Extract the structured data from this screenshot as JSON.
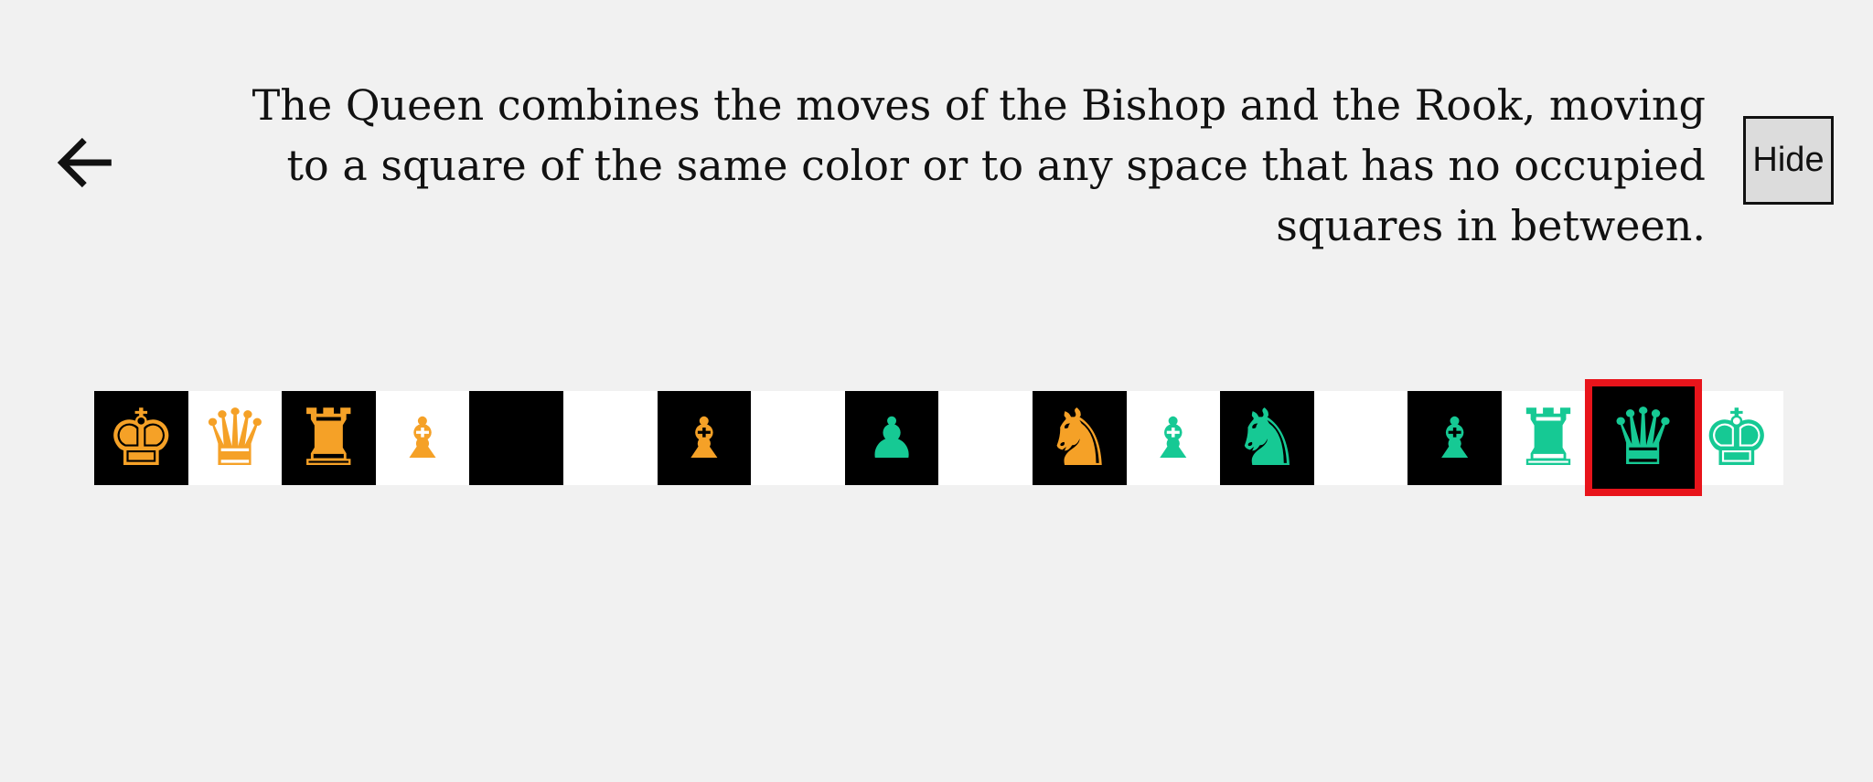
{
  "header": {
    "description": "The Queen combines the moves of the Bishop and the Rook, moving to a square of the same color or to any space that has no occupied squares in between.",
    "hide_label": "Hide",
    "back_icon": "arrow-left-icon"
  },
  "colors": {
    "background": "#f1f1f1",
    "orange_piece": "#f5a127",
    "green_piece": "#16c994",
    "selected_outline": "#e8141b"
  },
  "board_row": {
    "squares": [
      {
        "shade": "dark",
        "piece": "king",
        "color": "orange",
        "glyph": "♚",
        "selected": false
      },
      {
        "shade": "light",
        "piece": "queen",
        "color": "orange",
        "glyph": "♛",
        "selected": false
      },
      {
        "shade": "dark",
        "piece": "rook",
        "color": "orange",
        "glyph": "♜",
        "selected": false
      },
      {
        "shade": "light",
        "piece": "bishop",
        "color": "orange",
        "glyph": "♝",
        "selected": false
      },
      {
        "shade": "dark",
        "piece": "",
        "color": "",
        "glyph": "",
        "selected": false
      },
      {
        "shade": "light",
        "piece": "",
        "color": "",
        "glyph": "",
        "selected": false
      },
      {
        "shade": "dark",
        "piece": "bishop",
        "color": "orange",
        "glyph": "♝",
        "selected": false
      },
      {
        "shade": "light",
        "piece": "",
        "color": "",
        "glyph": "",
        "selected": false
      },
      {
        "shade": "dark",
        "piece": "pawn",
        "color": "green",
        "glyph": "♟",
        "selected": false
      },
      {
        "shade": "light",
        "piece": "",
        "color": "",
        "glyph": "",
        "selected": false
      },
      {
        "shade": "dark",
        "piece": "knight",
        "color": "orange",
        "glyph": "♞",
        "selected": false
      },
      {
        "shade": "light",
        "piece": "bishop",
        "color": "green",
        "glyph": "♝",
        "selected": false
      },
      {
        "shade": "dark",
        "piece": "knight",
        "color": "green",
        "glyph": "♞",
        "selected": false
      },
      {
        "shade": "light",
        "piece": "",
        "color": "",
        "glyph": "",
        "selected": false
      },
      {
        "shade": "dark",
        "piece": "bishop",
        "color": "green",
        "glyph": "♝",
        "selected": false
      },
      {
        "shade": "light",
        "piece": "rook",
        "color": "green",
        "glyph": "♜",
        "selected": false
      },
      {
        "shade": "dark",
        "piece": "queen",
        "color": "green",
        "glyph": "♛",
        "selected": true
      },
      {
        "shade": "light",
        "piece": "king",
        "color": "green",
        "glyph": "♚",
        "selected": false
      }
    ]
  }
}
